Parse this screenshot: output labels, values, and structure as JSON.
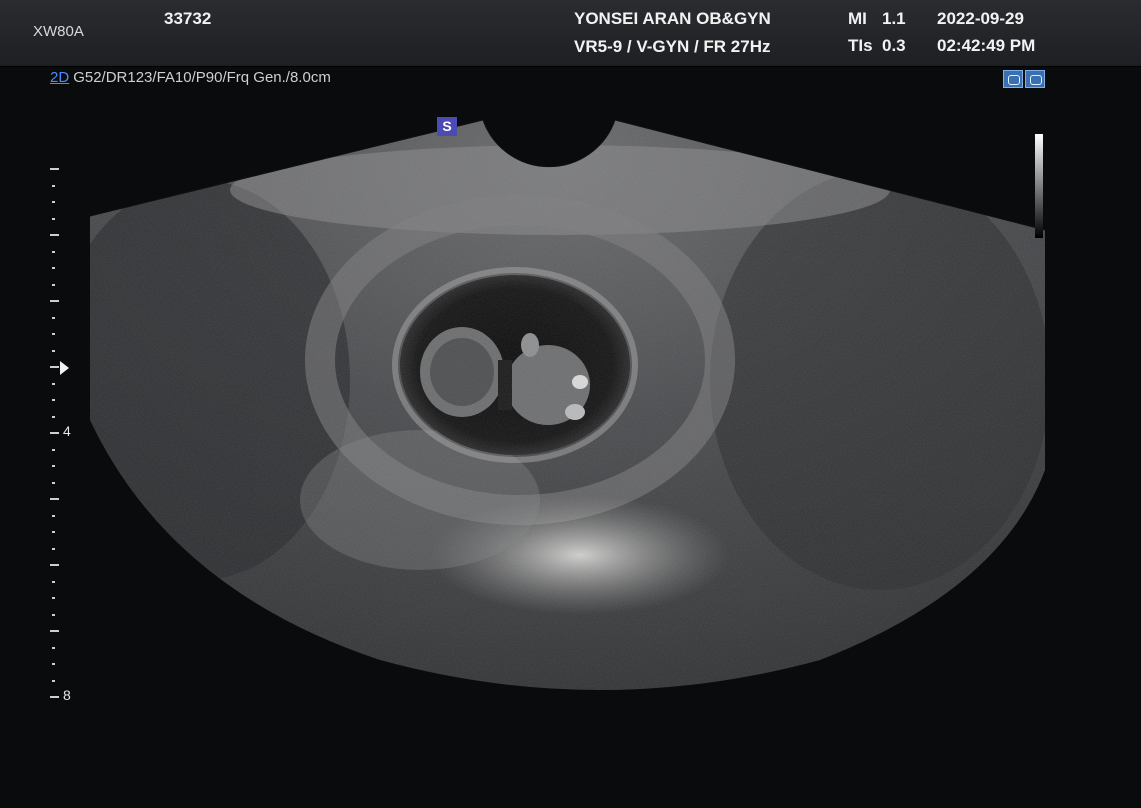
{
  "header": {
    "model": "XW80A",
    "patient_id": "33732",
    "institution": "YONSEI ARAN OB&GYN",
    "probe_settings": "VR5-9 / V-GYN / FR 27Hz",
    "mi_label": "MI",
    "mi_value": "1.1",
    "tis_label": "TIs",
    "tis_value": "0.3",
    "date": "2022-09-29",
    "time": "02:42:49 PM"
  },
  "scan_params": {
    "mode": "2D",
    "settings": "G52/DR123/FA10/P90/Frq Gen./8.0cm"
  },
  "orientation_marker": "S",
  "icons": [
    "probe-icon",
    "measure-icon"
  ],
  "depth_scale": {
    "unit": "cm",
    "max_depth": 8.0,
    "labels": [
      "4",
      "8"
    ],
    "focus_depth": 3
  },
  "colors": {
    "background": "#0a0b0d",
    "header_bg": "#25272b",
    "mode_accent": "#4a8cff",
    "marker_bg": "#4b4bb3"
  }
}
